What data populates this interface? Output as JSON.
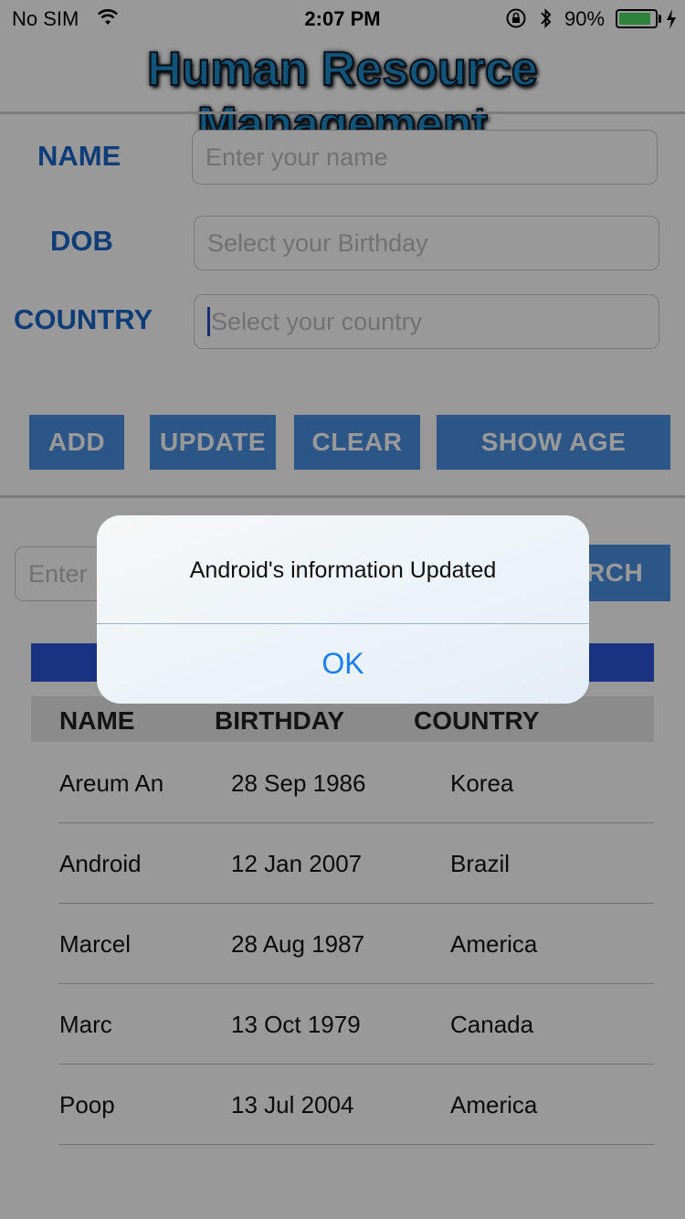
{
  "status_bar": {
    "carrier": "No SIM",
    "time": "2:07 PM",
    "battery_percent": "90%",
    "battery_level": 0.9
  },
  "header": {
    "title": "Human Resource Management"
  },
  "form": {
    "name_label": "NAME",
    "name_placeholder": "Enter your name",
    "dob_label": "DOB",
    "dob_placeholder": "Select your Birthday",
    "country_label": "COUNTRY",
    "country_placeholder": "Select your country"
  },
  "buttons": {
    "add": "ADD",
    "update": "UPDATE",
    "clear": "CLEAR",
    "show_age": "SHOW AGE"
  },
  "search": {
    "placeholder_visible": "Enter",
    "button_visible": "RCH"
  },
  "table": {
    "headers": [
      "NAME",
      "BIRTHDAY",
      "COUNTRY"
    ],
    "rows": [
      [
        "Areum An",
        "28 Sep 1986",
        "Korea"
      ],
      [
        "Android",
        "12 Jan 2007",
        "Brazil"
      ],
      [
        "Marcel",
        "28 Aug 1987",
        "America"
      ],
      [
        "Marc",
        "13 Oct 1979",
        "Canada"
      ],
      [
        "Poop",
        "13 Jul 2004",
        "America"
      ]
    ]
  },
  "alert": {
    "message": "Android's information Updated",
    "ok_label": "OK"
  },
  "colors": {
    "label_blue": "#1a67c9",
    "button_blue": "#4a8fe2",
    "table_bar_blue": "#2b56d9",
    "alert_ok_blue": "#1a7ef5",
    "battery_green": "#4cd964"
  }
}
